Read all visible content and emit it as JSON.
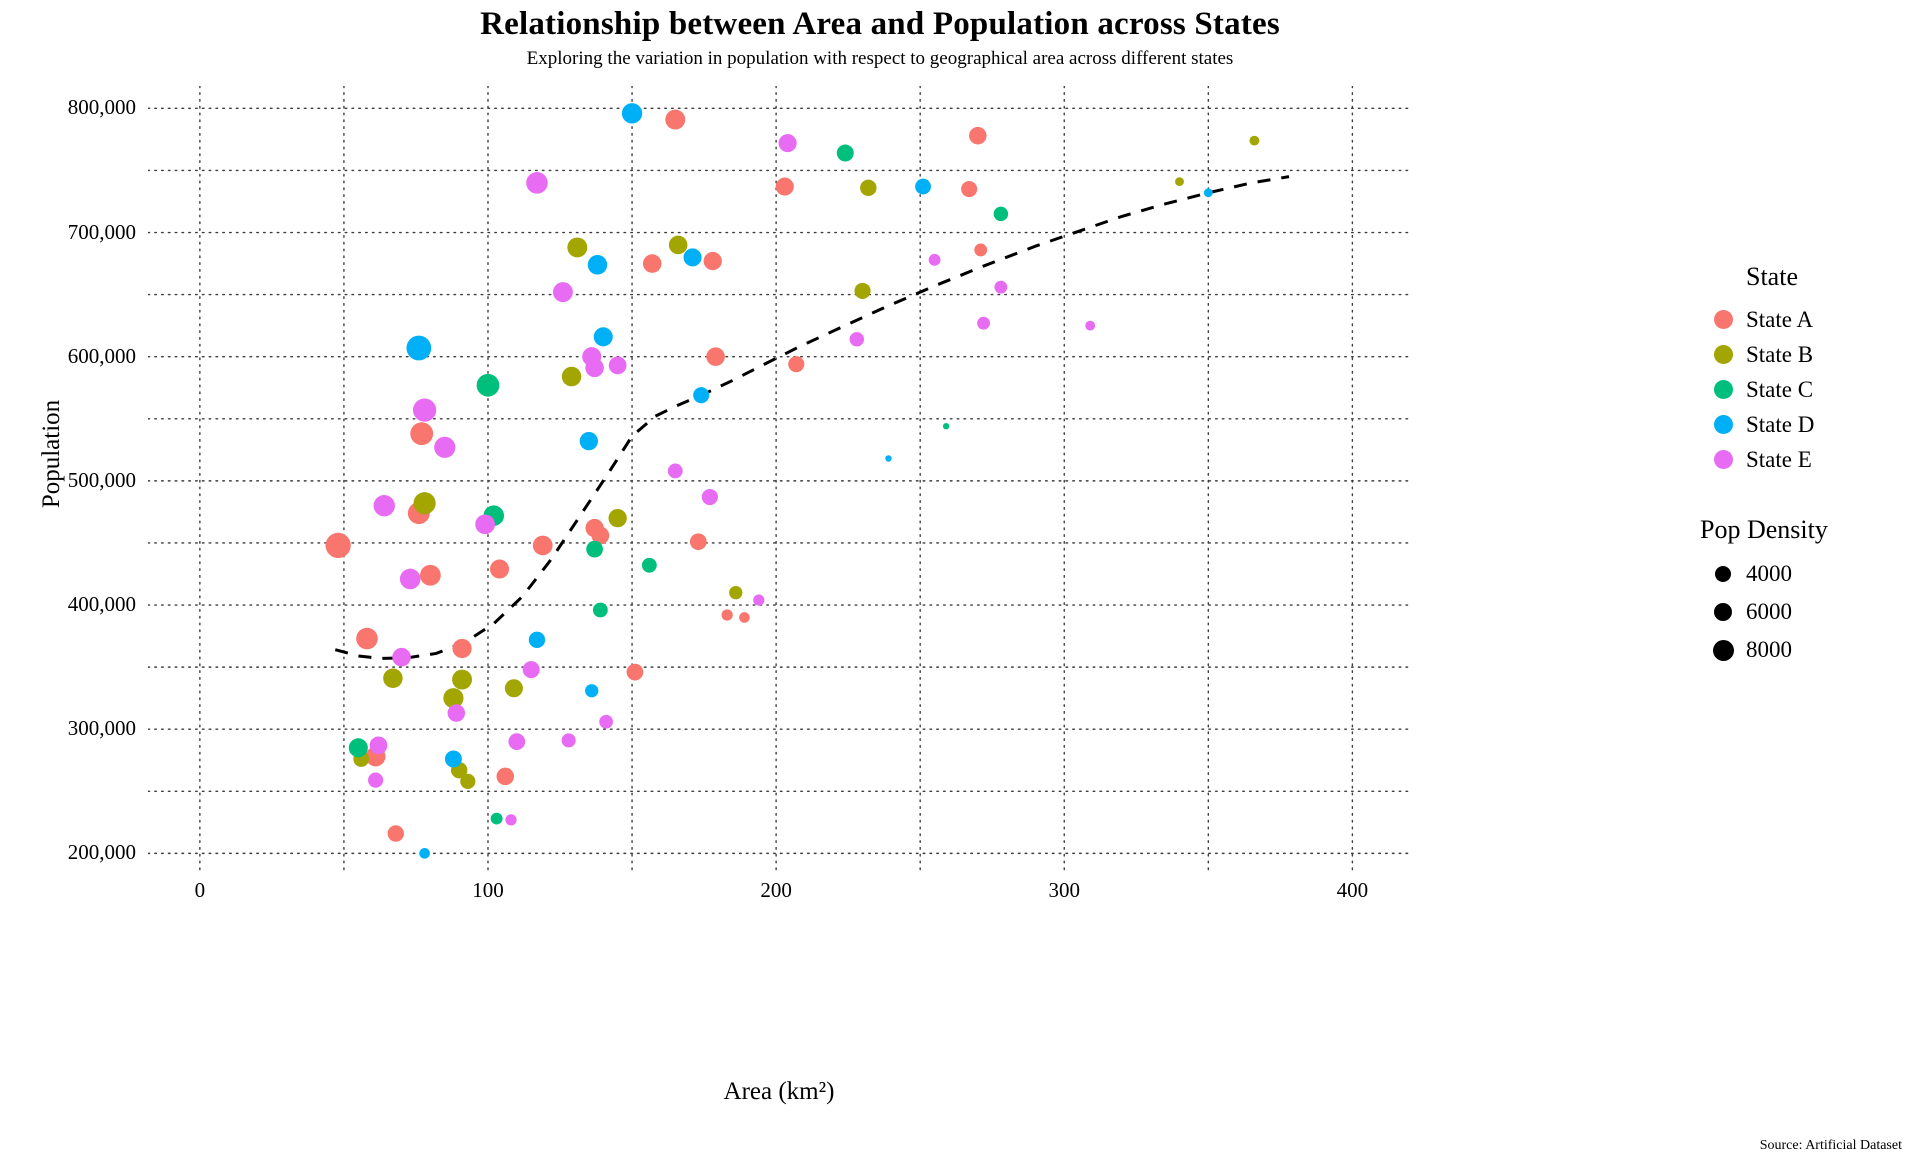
{
  "header": {
    "title": "Relationship between Area and Population across States",
    "subtitle": "Exploring the variation in population with respect to geographical area across different states"
  },
  "footer": {
    "source": "Source: Artificial Dataset"
  },
  "legend": {
    "color_title": "State",
    "size_title": "Pop Density",
    "color_items": [
      {
        "label": "State A",
        "color": "#F8766D"
      },
      {
        "label": "State B",
        "color": "#A3A500"
      },
      {
        "label": "State C",
        "color": "#00BF7D"
      },
      {
        "label": "State D",
        "color": "#00B0F6"
      },
      {
        "label": "State E",
        "color": "#E76BF3"
      }
    ],
    "size_items": [
      {
        "label": "4000",
        "r": 8
      },
      {
        "label": "6000",
        "r": 9
      },
      {
        "label": "8000",
        "r": 10.5
      }
    ]
  },
  "chart_data": {
    "type": "scatter",
    "title": "Relationship between Area and Population across States",
    "subtitle": "Exploring the variation in population with respect to geographical area across different states",
    "xlabel": "Area (km²)",
    "ylabel": "Population",
    "xlim": [
      -18,
      420
    ],
    "ylim": [
      185000,
      818000
    ],
    "xticks": [
      0,
      100,
      200,
      300,
      400
    ],
    "xticklabels": [
      "0",
      "100",
      "200",
      "300",
      "400"
    ],
    "xminorticks": [
      50,
      150,
      250,
      350
    ],
    "yticks": [
      200000,
      300000,
      400000,
      500000,
      600000,
      700000,
      800000
    ],
    "yticklabels": [
      "200,000",
      "300,000",
      "400,000",
      "500,000",
      "600,000",
      "700,000",
      "800,000"
    ],
    "yminorticks": [
      250000,
      350000,
      450000,
      550000,
      650000,
      750000
    ],
    "grid": true,
    "grid_style": "dotted",
    "legend_position": "right",
    "size_field": "Pop Density",
    "size_range": [
      2500,
      9000
    ],
    "trend_line": {
      "style": "dashed",
      "color": "#000000",
      "width": 3,
      "points": [
        [
          47,
          364000
        ],
        [
          55,
          359000
        ],
        [
          63,
          357000
        ],
        [
          72,
          357500
        ],
        [
          82,
          361000
        ],
        [
          92,
          370000
        ],
        [
          102,
          385000
        ],
        [
          112,
          407000
        ],
        [
          122,
          437000
        ],
        [
          132,
          472000
        ],
        [
          142,
          507000
        ],
        [
          150,
          536000
        ],
        [
          158,
          552000
        ],
        [
          166,
          561000
        ],
        [
          175,
          570000
        ],
        [
          185,
          581000
        ],
        [
          196,
          594000
        ],
        [
          208,
          608000
        ],
        [
          222,
          623000
        ],
        [
          238,
          640000
        ],
        [
          255,
          657000
        ],
        [
          272,
          673000
        ],
        [
          290,
          689000
        ],
        [
          305,
          701000
        ],
        [
          320,
          713000
        ],
        [
          335,
          723000
        ],
        [
          350,
          732000
        ],
        [
          365,
          740000
        ],
        [
          378,
          745000
        ]
      ]
    },
    "series": [
      {
        "name": "State A",
        "color": "#F8766D",
        "points": [
          {
            "x": 48,
            "y": 448000,
            "d": 8500
          },
          {
            "x": 58,
            "y": 373000,
            "d": 6400
          },
          {
            "x": 61,
            "y": 278000,
            "d": 5500
          },
          {
            "x": 77,
            "y": 538000,
            "d": 7100
          },
          {
            "x": 76,
            "y": 474000,
            "d": 6600
          },
          {
            "x": 80,
            "y": 424000,
            "d": 6000
          },
          {
            "x": 68,
            "y": 216000,
            "d": 4200
          },
          {
            "x": 91,
            "y": 365000,
            "d": 5300
          },
          {
            "x": 104,
            "y": 429000,
            "d": 5200
          },
          {
            "x": 106,
            "y": 262000,
            "d": 4600
          },
          {
            "x": 119,
            "y": 448000,
            "d": 5500
          },
          {
            "x": 137,
            "y": 462000,
            "d": 4900
          },
          {
            "x": 139,
            "y": 456000,
            "d": 4700
          },
          {
            "x": 151,
            "y": 346000,
            "d": 4300
          },
          {
            "x": 157,
            "y": 675000,
            "d": 5000
          },
          {
            "x": 165,
            "y": 791000,
            "d": 5600
          },
          {
            "x": 173,
            "y": 451000,
            "d": 4300
          },
          {
            "x": 178,
            "y": 677000,
            "d": 4900
          },
          {
            "x": 179,
            "y": 600000,
            "d": 5000
          },
          {
            "x": 183,
            "y": 392000,
            "d": 2900
          },
          {
            "x": 189,
            "y": 390000,
            "d": 2800
          },
          {
            "x": 203,
            "y": 737000,
            "d": 4800
          },
          {
            "x": 207,
            "y": 594000,
            "d": 4100
          },
          {
            "x": 267,
            "y": 735000,
            "d": 4100
          },
          {
            "x": 270,
            "y": 778000,
            "d": 4600
          },
          {
            "x": 271,
            "y": 686000,
            "d": 3200
          }
        ]
      },
      {
        "name": "State B",
        "color": "#A3A500",
        "points": [
          {
            "x": 56,
            "y": 276000,
            "d": 4000
          },
          {
            "x": 67,
            "y": 341000,
            "d": 5400
          },
          {
            "x": 78,
            "y": 482000,
            "d": 6700
          },
          {
            "x": 88,
            "y": 325000,
            "d": 5700
          },
          {
            "x": 91,
            "y": 340000,
            "d": 5600
          },
          {
            "x": 90,
            "y": 267000,
            "d": 4200
          },
          {
            "x": 93,
            "y": 258000,
            "d": 3800
          },
          {
            "x": 109,
            "y": 333000,
            "d": 4800
          },
          {
            "x": 129,
            "y": 584000,
            "d": 5400
          },
          {
            "x": 131,
            "y": 688000,
            "d": 5600
          },
          {
            "x": 145,
            "y": 470000,
            "d": 4900
          },
          {
            "x": 166,
            "y": 690000,
            "d": 5000
          },
          {
            "x": 186,
            "y": 410000,
            "d": 3300
          },
          {
            "x": 230,
            "y": 653000,
            "d": 4100
          },
          {
            "x": 232,
            "y": 736000,
            "d": 4200
          },
          {
            "x": 340,
            "y": 741000,
            "d": 2600
          },
          {
            "x": 366,
            "y": 774000,
            "d": 2700
          }
        ]
      },
      {
        "name": "State C",
        "color": "#00BF7D",
        "points": [
          {
            "x": 55,
            "y": 285000,
            "d": 5200
          },
          {
            "x": 100,
            "y": 577000,
            "d": 7000
          },
          {
            "x": 102,
            "y": 472000,
            "d": 5900
          },
          {
            "x": 103,
            "y": 228000,
            "d": 3000
          },
          {
            "x": 137,
            "y": 445000,
            "d": 4300
          },
          {
            "x": 139,
            "y": 396000,
            "d": 3700
          },
          {
            "x": 156,
            "y": 432000,
            "d": 3700
          },
          {
            "x": 224,
            "y": 764000,
            "d": 4400
          },
          {
            "x": 259,
            "y": 544000,
            "d": 2400
          },
          {
            "x": 278,
            "y": 715000,
            "d": 3600
          }
        ]
      },
      {
        "name": "State D",
        "color": "#00B0F6",
        "points": [
          {
            "x": 76,
            "y": 607000,
            "d": 8200
          },
          {
            "x": 78,
            "y": 200000,
            "d": 2800
          },
          {
            "x": 88,
            "y": 276000,
            "d": 4400
          },
          {
            "x": 117,
            "y": 372000,
            "d": 4200
          },
          {
            "x": 135,
            "y": 532000,
            "d": 4900
          },
          {
            "x": 136,
            "y": 331000,
            "d": 3300
          },
          {
            "x": 138,
            "y": 674000,
            "d": 5400
          },
          {
            "x": 140,
            "y": 616000,
            "d": 5200
          },
          {
            "x": 150,
            "y": 796000,
            "d": 5800
          },
          {
            "x": 171,
            "y": 680000,
            "d": 4800
          },
          {
            "x": 174,
            "y": 569000,
            "d": 4100
          },
          {
            "x": 239,
            "y": 518000,
            "d": 2400
          },
          {
            "x": 251,
            "y": 737000,
            "d": 4000
          },
          {
            "x": 350,
            "y": 732000,
            "d": 2600
          }
        ]
      },
      {
        "name": "State E",
        "color": "#E76BF3",
        "points": [
          {
            "x": 61,
            "y": 259000,
            "d": 3800
          },
          {
            "x": 62,
            "y": 287000,
            "d": 4700
          },
          {
            "x": 64,
            "y": 480000,
            "d": 6300
          },
          {
            "x": 70,
            "y": 358000,
            "d": 5000
          },
          {
            "x": 73,
            "y": 421000,
            "d": 5900
          },
          {
            "x": 78,
            "y": 557000,
            "d": 7300
          },
          {
            "x": 85,
            "y": 527000,
            "d": 6200
          },
          {
            "x": 89,
            "y": 313000,
            "d": 4600
          },
          {
            "x": 99,
            "y": 465000,
            "d": 5500
          },
          {
            "x": 108,
            "y": 227000,
            "d": 2900
          },
          {
            "x": 110,
            "y": 290000,
            "d": 4300
          },
          {
            "x": 115,
            "y": 348000,
            "d": 4400
          },
          {
            "x": 117,
            "y": 740000,
            "d": 6400
          },
          {
            "x": 126,
            "y": 652000,
            "d": 5600
          },
          {
            "x": 128,
            "y": 291000,
            "d": 3500
          },
          {
            "x": 136,
            "y": 600000,
            "d": 5200
          },
          {
            "x": 137,
            "y": 591000,
            "d": 5000
          },
          {
            "x": 141,
            "y": 306000,
            "d": 3400
          },
          {
            "x": 145,
            "y": 593000,
            "d": 4700
          },
          {
            "x": 165,
            "y": 508000,
            "d": 3700
          },
          {
            "x": 177,
            "y": 487000,
            "d": 4100
          },
          {
            "x": 194,
            "y": 404000,
            "d": 2900
          },
          {
            "x": 204,
            "y": 772000,
            "d": 4800
          },
          {
            "x": 228,
            "y": 614000,
            "d": 3600
          },
          {
            "x": 255,
            "y": 678000,
            "d": 3000
          },
          {
            "x": 272,
            "y": 627000,
            "d": 3200
          },
          {
            "x": 278,
            "y": 656000,
            "d": 3200
          },
          {
            "x": 309,
            "y": 625000,
            "d": 2700
          }
        ]
      }
    ]
  }
}
